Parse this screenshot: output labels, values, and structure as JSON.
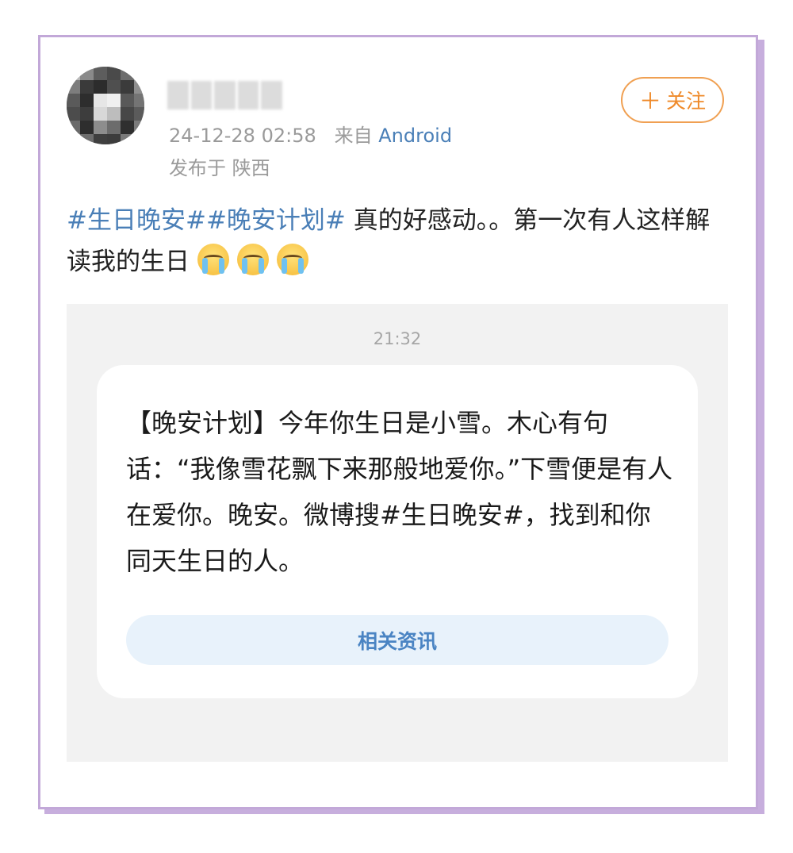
{
  "post": {
    "timestamp": "24-12-28 02:58",
    "source_prefix": "来自",
    "source_device": "Android",
    "location": "发布于 陕西",
    "follow_label": "关注",
    "hashtags": "#生日晚安##晚安计划#",
    "body": " 真的好感动。。第一次有人这样解读我的生日",
    "emojis": [
      "crying-emoji",
      "crying-emoji",
      "crying-emoji"
    ]
  },
  "screenshot": {
    "time": "21:32",
    "message": "【晚安计划】今年你生日是小雪。木心有句话：“我像雪花飘下来那般地爱你。”下雪便是有人在爱你。晚安。微博搜#生日晚安#，找到和你同天生日的人。",
    "related_label": "相关资讯"
  },
  "colors": {
    "frame_border": "#c2a8d8",
    "link_blue": "#4a7fb7",
    "follow_orange": "#ef8a2a",
    "related_bg": "#e8f2fb"
  }
}
